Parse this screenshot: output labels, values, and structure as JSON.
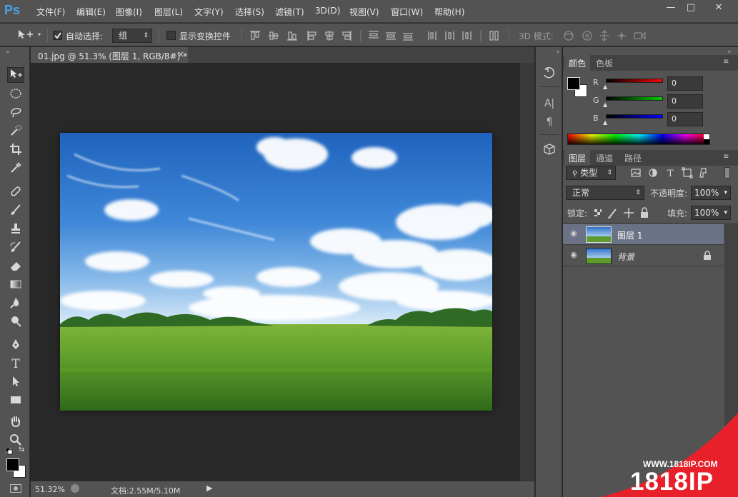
{
  "app": {
    "logo": "Ps"
  },
  "menu": {
    "items": [
      "文件(F)",
      "编辑(E)",
      "图像(I)",
      "图层(L)",
      "文字(Y)",
      "选择(S)",
      "滤镜(T)",
      "3D(D)",
      "视图(V)",
      "窗口(W)",
      "帮助(H)"
    ]
  },
  "window": {
    "minimize": "—",
    "maximize": "□",
    "close": "✕"
  },
  "options": {
    "auto_select_label": "自动选择:",
    "auto_select_checked": true,
    "auto_select_value": "组",
    "show_transform_label": "显示变换控件",
    "show_transform_checked": false,
    "mode_3d_label": "3D 模式:"
  },
  "document": {
    "tab_title": "01.jpg @ 51.3% (图层 1, RGB/8#) *",
    "tab_close": "×",
    "zoom": "51.32%",
    "doc_info": "文档:2.55M/5.10M"
  },
  "color_panel": {
    "tabs": [
      "颜色",
      "色板"
    ],
    "active_tab": "颜色",
    "channels": [
      {
        "label": "R",
        "value": "0",
        "color": "#ff0000"
      },
      {
        "label": "G",
        "value": "0",
        "color": "#00cc00"
      },
      {
        "label": "B",
        "value": "0",
        "color": "#0000ff"
      }
    ],
    "foreground": "#000000",
    "background": "#ffffff"
  },
  "layers_panel": {
    "tabs": [
      "图层",
      "通道",
      "路径"
    ],
    "active_tab": "图层",
    "filter_label": "类型",
    "blend_mode": "正常",
    "opacity_label": "不透明度:",
    "opacity_value": "100%",
    "lock_label": "锁定:",
    "fill_label": "填充:",
    "fill_value": "100%",
    "layers": [
      {
        "name": "图层 1",
        "selected": true,
        "locked": false
      },
      {
        "name": "背景",
        "selected": false,
        "locked": true
      }
    ]
  },
  "watermark": {
    "url": "WWW.1818IP.COM",
    "brand": "1818IP",
    "color": "#e8202a"
  }
}
